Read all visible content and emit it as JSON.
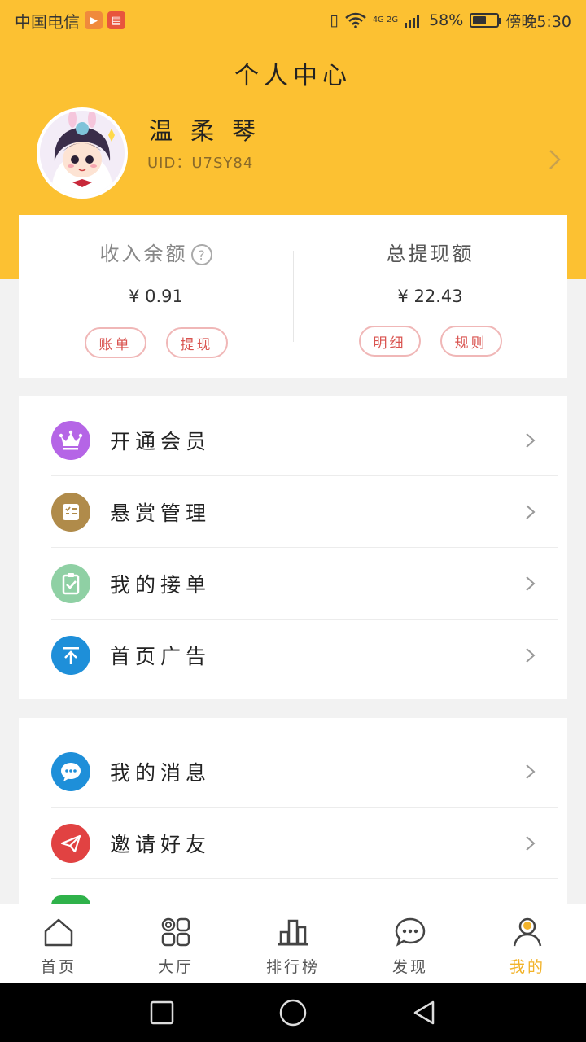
{
  "status_bar": {
    "carrier": "中国电信",
    "signal_text": "4G 2G",
    "battery_percent": "58%",
    "battery_level": 0.58,
    "time": "傍晚5:30"
  },
  "header": {
    "title": "个人中心"
  },
  "profile": {
    "name": "温柔琴",
    "uid": "UID：U7SY84"
  },
  "balance": {
    "income_label": "收入余额",
    "income_value": "¥ 0.91",
    "income_buttons": [
      "账单",
      "提现"
    ],
    "withdraw_label": "总提现额",
    "withdraw_value": "¥ 22.43",
    "withdraw_buttons": [
      "明细",
      "规则"
    ]
  },
  "menu_group_1": [
    {
      "label": "开通会员",
      "icon": "crown-icon",
      "color": "#b565e6"
    },
    {
      "label": "悬赏管理",
      "icon": "list-icon",
      "color": "#b08b4a"
    },
    {
      "label": "我的接单",
      "icon": "clipboard-check-icon",
      "color": "#8fd0a4"
    },
    {
      "label": "首页广告",
      "icon": "arrow-up-icon",
      "color": "#1e8fd9"
    }
  ],
  "menu_group_2": [
    {
      "label": "我的消息",
      "icon": "chat-bubble-icon",
      "color": "#1e8fd9"
    },
    {
      "label": "邀请好友",
      "icon": "paper-plane-icon",
      "color": "#e14242"
    }
  ],
  "tabbar": {
    "tabs": [
      {
        "label": "首页",
        "icon": "home-icon"
      },
      {
        "label": "大厅",
        "icon": "grid-icon"
      },
      {
        "label": "排行榜",
        "icon": "ranking-icon"
      },
      {
        "label": "发现",
        "icon": "chat-icon"
      },
      {
        "label": "我的",
        "icon": "person-icon"
      }
    ],
    "active_index": 4,
    "active_color": "#f2b32a"
  },
  "colors": {
    "brand_yellow": "#fcc132",
    "pill_red": "#d9534f"
  }
}
